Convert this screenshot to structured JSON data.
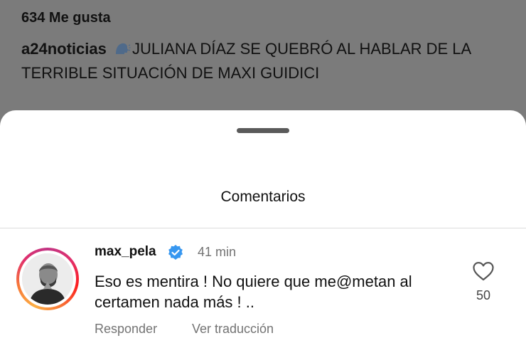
{
  "post": {
    "likes": "634 Me gusta",
    "author": "a24noticias",
    "emoji_icon": "speaking-head-icon",
    "caption": "JULIANA DÍAZ SE QUEBRÓ AL HABLAR DE LA TERRIBLE SITUACIÓN DE MAXI GUIDICI"
  },
  "sheet": {
    "title": "Comentarios"
  },
  "comment": {
    "username": "max_pela",
    "verified_icon": "verified-badge-icon",
    "time": "41 min",
    "text": "Eso es mentira ! No quiere que me@metan al certamen nada más ! ..",
    "reply_label": "Responder",
    "translate_label": "Ver traducción",
    "like_icon": "heart-icon",
    "like_count": "50"
  },
  "colors": {
    "overlay": "#7b7b7b",
    "verified": "#3797f0",
    "secondary_text": "#737373",
    "ring_start": "#c13584",
    "ring_end": "#fcaf45"
  }
}
